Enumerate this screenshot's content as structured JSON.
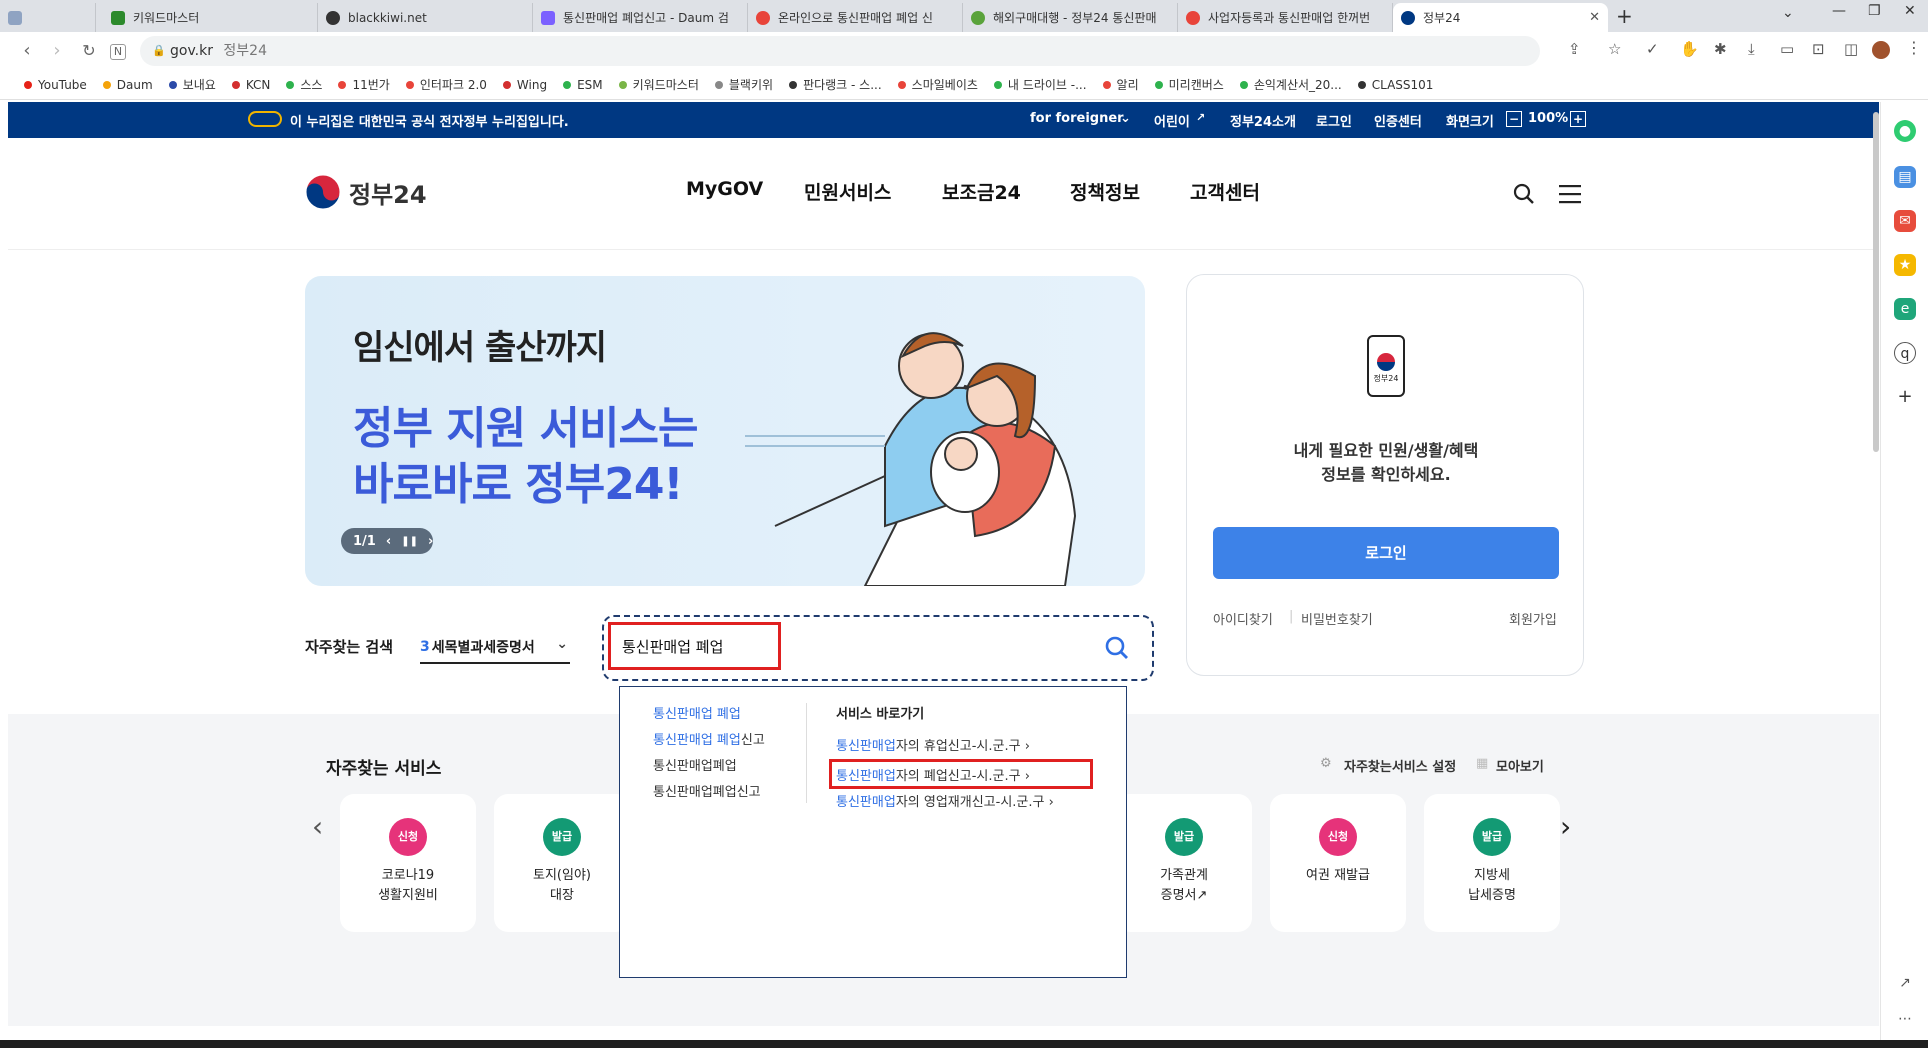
{
  "browser": {
    "tabs": [
      {
        "label": "",
        "color": "#8fa3c2",
        "active": false
      },
      {
        "label": "키워드마스터",
        "color": "#2c8a2c",
        "active": false
      },
      {
        "label": "blackkiwi.net",
        "color": "#333333",
        "active": false
      },
      {
        "label": "통신판매업 폐업신고 - Daum 검",
        "color": "#7b61ff",
        "active": false
      },
      {
        "label": "온라인으로 통신판매업 폐업 신",
        "color": "#e8443a",
        "active": false
      },
      {
        "label": "해외구매대행 - 정부24 통신판매",
        "color": "#5aa33b",
        "active": false
      },
      {
        "label": "사업자등록과 통신판매업 한꺼번",
        "color": "#e8443a",
        "active": false
      },
      {
        "label": "정부24",
        "color": "#003882",
        "active": true
      }
    ],
    "new_tab": "+",
    "url": "gov.kr",
    "url_title": "정부24",
    "bookmarks": [
      {
        "label": "YouTube",
        "color": "#e62117"
      },
      {
        "label": "Daum",
        "color": "#f4a30a"
      },
      {
        "label": "보내요",
        "color": "#2b4aa8"
      },
      {
        "label": "KCN",
        "color": "#d32f2f"
      },
      {
        "label": "스스",
        "color": "#2eb24d"
      },
      {
        "label": "11번가",
        "color": "#e8443a"
      },
      {
        "label": "인터파크 2.0",
        "color": "#e8443a"
      },
      {
        "label": "Wing",
        "color": "#d32f2f"
      },
      {
        "label": "ESM",
        "color": "#2eb24d"
      },
      {
        "label": "키워드마스터",
        "color": "#7ab547"
      },
      {
        "label": "블랙키위",
        "color": "#888888"
      },
      {
        "label": "판다랭크 - 스...",
        "color": "#333333"
      },
      {
        "label": "스마일베이츠",
        "color": "#e8443a"
      },
      {
        "label": "내 드라이브 -...",
        "color": "#2eb24d"
      },
      {
        "label": "알리",
        "color": "#e8443a"
      },
      {
        "label": "미리캔버스",
        "color": "#2eb24d"
      },
      {
        "label": "손익계산서_20...",
        "color": "#2eb24d"
      },
      {
        "label": "CLASS101",
        "color": "#333333"
      }
    ]
  },
  "govbar": {
    "notice": "이 누리집은 대한민국 공식 전자정부 누리집입니다.",
    "links": [
      "for foreigner",
      "어린이",
      "정부24소개",
      "로그인",
      "인증센터",
      "화면크기"
    ],
    "zoom": "100%",
    "minus": "−",
    "plus": "+"
  },
  "header": {
    "logo_text": "정부24",
    "nav": [
      "MyGOV",
      "민원서비스",
      "보조금24",
      "정책정보",
      "고객센터"
    ]
  },
  "hero": {
    "line1": "임신에서 출산까지",
    "line2": "정부 지원 서비스는",
    "line3": "바로바로 정부24!",
    "pager": "1/1"
  },
  "login_card": {
    "phone_label": "정부24",
    "message_line1": "내게 필요한 민원/생활/혜택",
    "message_line2": "정보를 확인하세요.",
    "login_button": "로그인",
    "find_id": "아이디찾기",
    "find_pw": "비밀번호찾기",
    "signup": "회원가입"
  },
  "search": {
    "label": "자주찾는 검색",
    "rank_number": "3",
    "rank_keyword": "세목별과세증명서",
    "query": "통신판매업 폐업"
  },
  "suggest": {
    "left": [
      {
        "hl": "통신판매업 폐업",
        "rest": ""
      },
      {
        "hl": "통신판매업 폐업",
        "rest": "신고"
      },
      {
        "hl": "",
        "rest": "통신판매업폐업"
      },
      {
        "hl": "",
        "rest": "통신판매업폐업신고"
      }
    ],
    "right_title": "서비스 바로가기",
    "right": [
      {
        "hl": "통신판매업",
        "rest": "자의 휴업신고-시.군.구"
      },
      {
        "hl": "통신판매업",
        "rest": "자의 폐업신고-시.군.구"
      },
      {
        "hl": "통신판매업",
        "rest": "자의 영업재개신고-시.군.구"
      }
    ],
    "chevron": "›"
  },
  "services": {
    "title": "자주찾는 서비스",
    "settings": "자주찾는서비스 설정",
    "viewall": "모아보기",
    "cards": [
      {
        "badge": "신청",
        "color": "#e6337a",
        "label": "코로나19\n생활지원비"
      },
      {
        "badge": "발급",
        "color": "#139a74",
        "label": "토지(임야)\n대장"
      },
      {
        "badge": "발급",
        "color": "#139a74",
        "label": "가족관계\n증명서↗"
      },
      {
        "badge": "신청",
        "color": "#e6337a",
        "label": "여권 재발급"
      },
      {
        "badge": "발급",
        "color": "#139a74",
        "label": "지방세\n납세증명"
      }
    ]
  },
  "colors": {
    "gov_navy": "#003882",
    "accent_blue": "#2f6fe4",
    "highlight_red": "#e02020"
  }
}
